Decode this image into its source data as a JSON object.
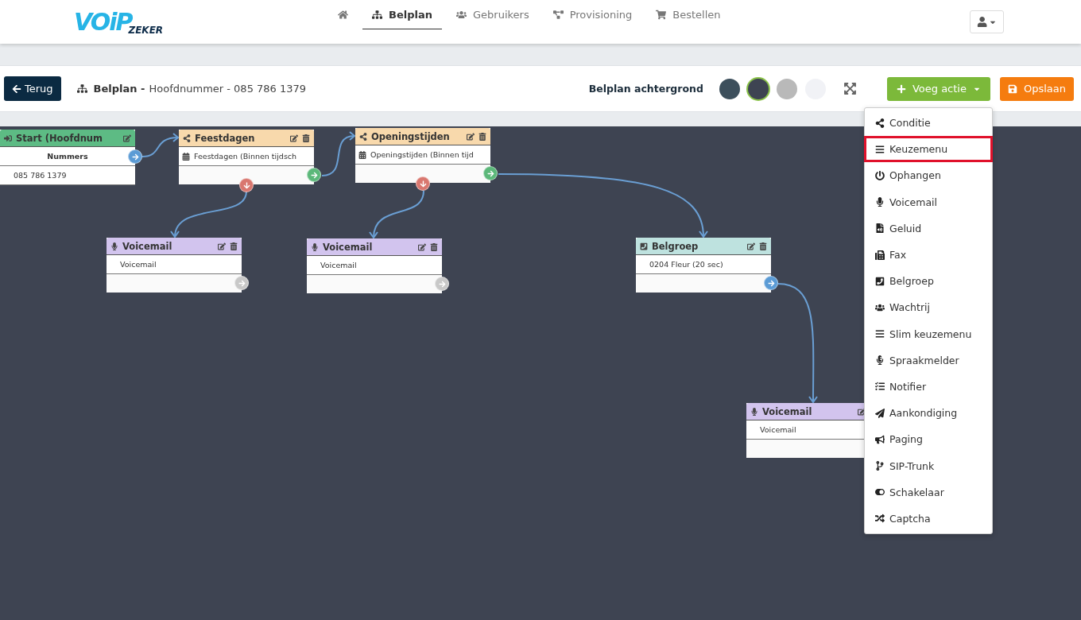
{
  "logo": {
    "mark": "VOiP",
    "sub": "ZEKER"
  },
  "nav": [
    {
      "kind": "home",
      "selected": false
    },
    {
      "kind": "plan",
      "label": "Belplan",
      "selected": true
    },
    {
      "kind": "users",
      "label": "Gebruikers",
      "selected": false
    },
    {
      "kind": "provisioning",
      "label": "Provisioning",
      "selected": false
    },
    {
      "kind": "cart",
      "label": "Bestellen",
      "selected": false
    }
  ],
  "toolbar": {
    "back": "Terug",
    "title": "Belplan -",
    "subtitle": "Hoofdnummer - 085 786 1379",
    "background_label": "Belplan achtergrond",
    "swatches": [
      {
        "color": "#3d4f5c",
        "selected": false
      },
      {
        "color": "#3e4452",
        "selected": true
      },
      {
        "color": "#b9b9b9",
        "selected": false
      },
      {
        "color": "#f1f2f6",
        "selected": false
      }
    ],
    "add": "Voeg actie",
    "save": "Opslaan"
  },
  "nodes": [
    {
      "kind": "start",
      "title": "Start (Hoofdnum",
      "deletable": false,
      "footer": false,
      "rows": [
        {
          "kind": "heading",
          "text": "Nummers"
        },
        {
          "kind": "item",
          "text": "085 786 1379"
        }
      ],
      "ports": [
        {
          "kind": "row",
          "color": "#5b9bd5"
        }
      ]
    },
    {
      "kind": "condition",
      "title": "Feestdagen",
      "deletable": true,
      "footer": true,
      "rows": [
        {
          "kind": "date",
          "text": "Feestdagen (Binnen tijdsch"
        }
      ],
      "ports": [
        {
          "kind": "footer",
          "color": "#5cb87a"
        },
        {
          "kind": "bottom",
          "color": "#d9776f"
        }
      ]
    },
    {
      "kind": "condition",
      "title": "Openingstijden",
      "deletable": true,
      "footer": true,
      "rows": [
        {
          "kind": "date",
          "text": "Openingstijden (Binnen tijd"
        }
      ],
      "ports": [
        {
          "kind": "footer",
          "color": "#5cb87a"
        },
        {
          "kind": "bottom",
          "color": "#d9776f"
        }
      ]
    },
    {
      "kind": "voicemail",
      "title": "Voicemail",
      "deletable": true,
      "footer": true,
      "rows": [
        {
          "kind": "item",
          "text": "Voicemail"
        }
      ],
      "ports": [
        {
          "kind": "footer",
          "color": "#c8c8c8"
        }
      ]
    },
    {
      "kind": "voicemail",
      "title": "Voicemail",
      "deletable": true,
      "footer": true,
      "rows": [
        {
          "kind": "item",
          "text": "Voicemail"
        }
      ],
      "ports": [
        {
          "kind": "footer",
          "color": "#c8c8c8"
        }
      ]
    },
    {
      "kind": "group",
      "title": "Belgroep",
      "deletable": true,
      "footer": true,
      "rows": [
        {
          "kind": "item",
          "text": "0204 Fleur (20 sec)"
        }
      ],
      "ports": [
        {
          "kind": "footer",
          "color": "#5b9bd5"
        }
      ]
    },
    {
      "kind": "voicemail",
      "title": "Voicemail",
      "deletable": false,
      "footer": true,
      "rows": [
        {
          "kind": "item",
          "text": "Voicemail"
        }
      ]
    }
  ],
  "menu": [
    {
      "kind": "share",
      "label": "Conditie",
      "selected": false
    },
    {
      "kind": "bars",
      "label": "Keuzemenu",
      "selected": true
    },
    {
      "kind": "power",
      "label": "Ophangen",
      "selected": false
    },
    {
      "kind": "mic",
      "label": "Voicemail",
      "selected": false
    },
    {
      "kind": "audio",
      "label": "Geluid",
      "selected": false
    },
    {
      "kind": "fax",
      "label": "Fax",
      "selected": false
    },
    {
      "kind": "phone",
      "label": "Belgroep",
      "selected": false
    },
    {
      "kind": "users",
      "label": "Wachtrij",
      "selected": false
    },
    {
      "kind": "bars",
      "label": "Slim keuzemenu",
      "selected": false
    },
    {
      "kind": "micalt",
      "label": "Spraakmelder",
      "selected": false
    },
    {
      "kind": "tasks",
      "label": "Notifier",
      "selected": false
    },
    {
      "kind": "plane",
      "label": "Aankondiging",
      "selected": false
    },
    {
      "kind": "horn",
      "label": "Paging",
      "selected": false
    },
    {
      "kind": "branch",
      "label": "SIP-Trunk",
      "selected": false
    },
    {
      "kind": "toggle",
      "label": "Schakelaar",
      "selected": false
    },
    {
      "kind": "random",
      "label": "Captcha",
      "selected": false
    }
  ]
}
